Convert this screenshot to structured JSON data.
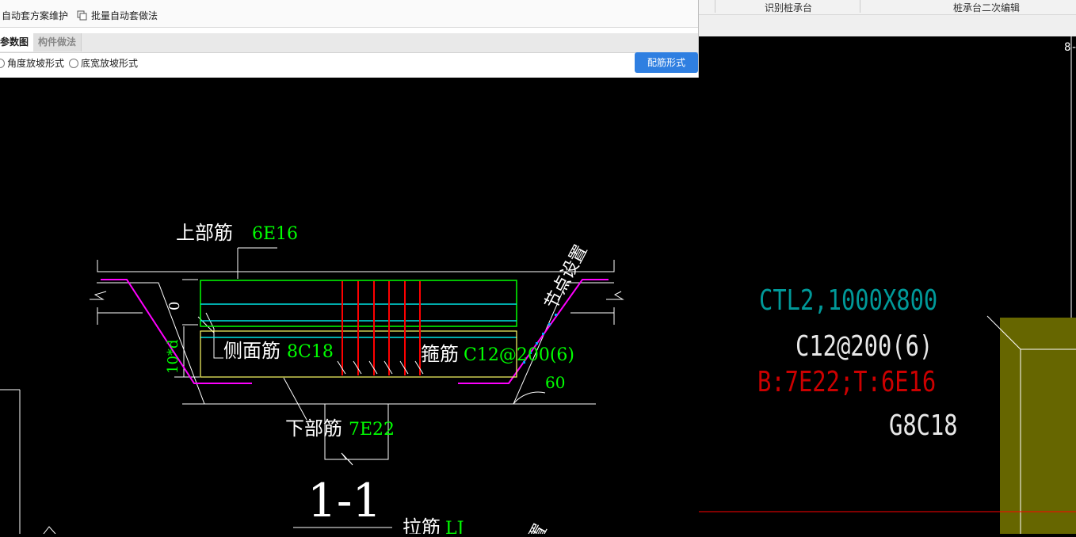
{
  "right_toolbar": {
    "item1": "识别桩承台",
    "item2": "桩承台二次编辑"
  },
  "dialog": {
    "tools": {
      "auto_scheme": "自动套方案维护",
      "batch_auto": "批量自动套做法"
    },
    "tabs": {
      "param_diagram": "参数图",
      "component_method": "构件做法"
    },
    "radios": {
      "angle_slope": "角度放坡形式",
      "bottom_width_slope": "底宽放坡形式"
    },
    "config_button": "配筋形式"
  },
  "drawing": {
    "top_bar_label": "上部筋",
    "top_bar_value": "6E16",
    "side_bar_label": "侧面筋",
    "side_bar_value": "8C18",
    "stirrup_label": "箍筋",
    "stirrup_value": "C12@200(6)",
    "bottom_bar_label": "下部筋",
    "bottom_bar_value": "7E22",
    "node_setting": "节点设置",
    "zero": "0",
    "ten_d": "10*d",
    "angle": "60",
    "section": "1-1",
    "tie_bar_label": "拉筋",
    "tie_bar_value": "LJ",
    "cut_text": "置"
  },
  "cad": {
    "corner": "8-",
    "ctl_label": "CTL2,1000X800",
    "stirrup": "C12@200(6)",
    "rebar": "B:7E22;T:6E16",
    "side": "G8C18"
  },
  "colors": {
    "green": "#00ff00",
    "cyan": "#00e5e5",
    "red": "#ff0000",
    "magenta": "#ff00ff",
    "yellow": "#ffff66",
    "teal": "#009999",
    "olive": "#666600",
    "accent": "#2f7fe1"
  }
}
